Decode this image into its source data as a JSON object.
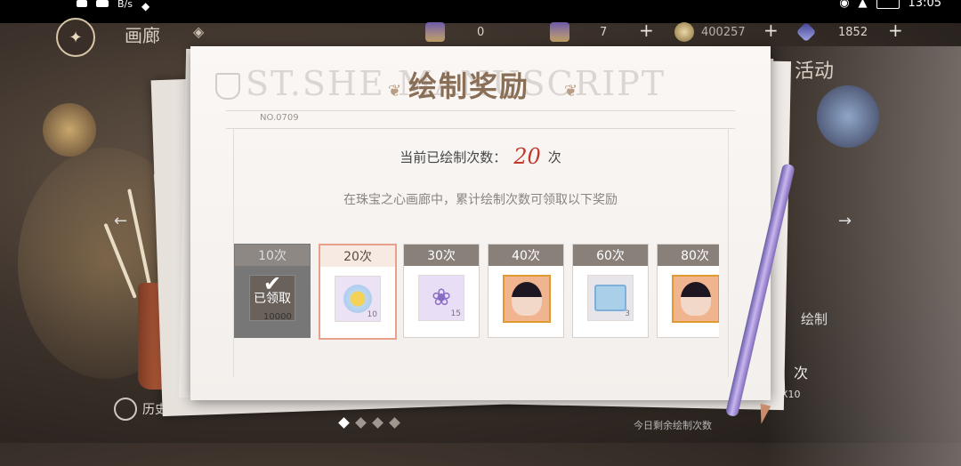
{
  "statusbar": {
    "net_speed": "B/s",
    "time": "13:05"
  },
  "hud": {
    "gallery_title": "画廊",
    "resources": [
      {
        "value": "0"
      },
      {
        "value": "7"
      },
      {
        "value": "400257"
      },
      {
        "value": "1852"
      }
    ]
  },
  "sheet": {
    "watermark": "ST.SHE  MANUSCRIPT",
    "title": "绘制奖励",
    "number": "NO.0709",
    "count_label": "当前已绘制次数：",
    "count_value": "20",
    "count_unit": "次",
    "description": "在珠宝之心画廊中，累计绘制次数可领取以下奖励"
  },
  "rewards": [
    {
      "label": "10次",
      "status": "已领取",
      "qty": "10000",
      "icon": "coin-icon",
      "state": "claimed"
    },
    {
      "label": "20次",
      "qty": "10",
      "icon": "sun-badge-icon",
      "state": "current"
    },
    {
      "label": "30次",
      "qty": "15",
      "icon": "butterfly-icon",
      "state": "locked"
    },
    {
      "label": "40次",
      "qty": "",
      "icon": "character-portrait-icon",
      "state": "locked"
    },
    {
      "label": "60次",
      "qty": "3",
      "icon": "gift-box-icon",
      "state": "locked"
    },
    {
      "label": "80次",
      "qty": "",
      "icon": "character-portrait-icon",
      "state": "locked"
    }
  ],
  "side": {
    "activity": "活动",
    "draw": "绘制",
    "times": "次",
    "x10": "X10",
    "history": "历史记录",
    "bottom_hint": "今日剩余绘制次数"
  },
  "colors": {
    "accent_red": "#c0392b",
    "title_brown": "#8a6f58"
  }
}
